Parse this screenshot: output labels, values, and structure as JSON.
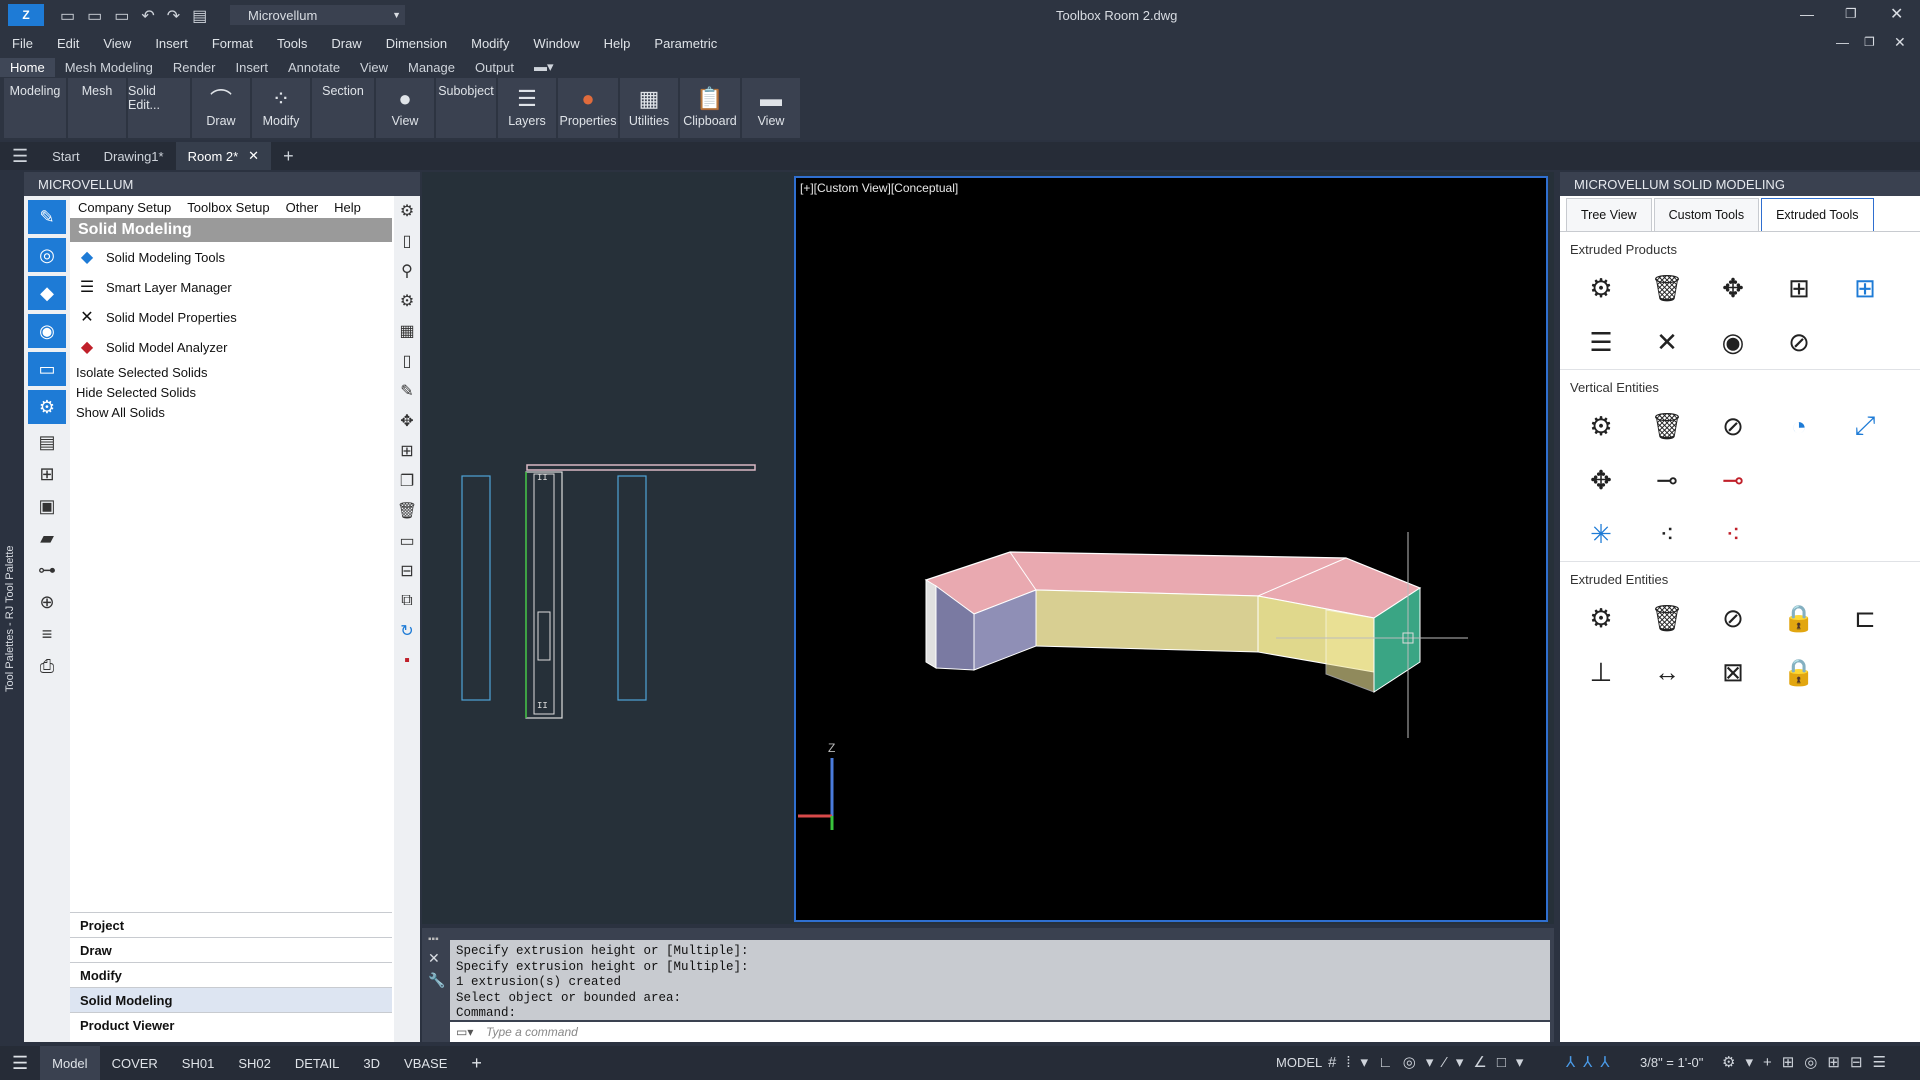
{
  "titlebar": {
    "workspace": "Microvellum",
    "title": "Toolbox    Room 2.dwg"
  },
  "menubar": [
    "File",
    "Edit",
    "View",
    "Insert",
    "Format",
    "Tools",
    "Draw",
    "Dimension",
    "Modify",
    "Window",
    "Help",
    "Parametric"
  ],
  "ribbon_tabs": [
    "Home",
    "Mesh Modeling",
    "Render",
    "Insert",
    "Annotate",
    "View",
    "Manage",
    "Output"
  ],
  "ribbon_panels": [
    "Modeling",
    "Mesh",
    "Solid Edit...",
    "Draw",
    "Modify",
    "Section",
    "View",
    "Subobject",
    "Layers",
    "Properties",
    "Utilities",
    "Clipboard",
    "View"
  ],
  "file_tabs": [
    "Start",
    "Drawing1*",
    "Room 2*"
  ],
  "left_palette": {
    "header": "MICROVELLUM",
    "vertical_label": "Tool Palettes - RJ Tool Palette",
    "menu": [
      "Company Setup",
      "Toolbox Setup",
      "Other",
      "Help"
    ],
    "title": "Solid Modeling",
    "items": [
      "Solid Modeling Tools",
      "Smart Layer Manager",
      "Solid Model Properties",
      "Solid Model Analyzer"
    ],
    "small_items": [
      "Isolate Selected Solids",
      "Hide Selected Solids",
      "Show All Solids"
    ],
    "accordion": [
      "Project",
      "Draw",
      "Modify",
      "Solid Modeling",
      "Product Viewer"
    ]
  },
  "viewport": {
    "label": "[+][Custom View][Conceptual]"
  },
  "right_palette": {
    "header": "MICROVELLUM SOLID MODELING",
    "tabs": [
      "Tree View",
      "Custom Tools",
      "Extruded Tools"
    ],
    "sections": [
      "Extruded Products",
      "Vertical Entities",
      "Extruded Entities"
    ]
  },
  "command": {
    "history": [
      "Specify extrusion height or [Multiple]:",
      "Specify extrusion height or [Multiple]:",
      "1 extrusion(s) created",
      "Select object or bounded area:",
      "Command:"
    ],
    "placeholder": "Type a command"
  },
  "status": {
    "layout_tabs": [
      "Model",
      "COVER",
      "SH01",
      "SH02",
      "DETAIL",
      "3D",
      "VBASE"
    ],
    "mode": "MODEL",
    "scale": "3/8\" = 1'-0\""
  },
  "colors": {
    "accent": "#1e7bd6",
    "viewport_border": "#2f6fd0"
  }
}
